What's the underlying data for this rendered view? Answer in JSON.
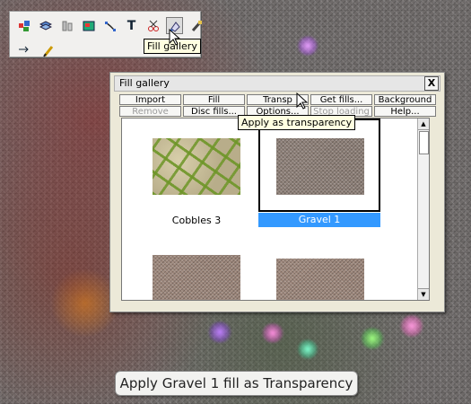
{
  "toolbar": {
    "icons": [
      "quick-shapes-icon",
      "layers-icon",
      "bars-icon",
      "bitmap-icon",
      "shape-editor-icon",
      "text-icon",
      "knife-icon",
      "fill-icon",
      "transparency-icon"
    ],
    "tooltip": "Fill gallery",
    "row2_icons": [
      "pointer-icon",
      "pen-icon"
    ]
  },
  "dialog": {
    "title": "Fill gallery",
    "close": "X",
    "row1": [
      "Import",
      "Fill",
      "Transp",
      "Get fills...",
      "Background"
    ],
    "row2": [
      "Remove",
      "Disc fills...",
      "Options...",
      "Stop loading",
      "Help..."
    ],
    "row2_disabled": [
      true,
      false,
      false,
      true,
      false
    ],
    "tooltip": "Apply as transparency",
    "items": [
      {
        "name": "Cobbles 3",
        "selected": false
      },
      {
        "name": "Gravel 1",
        "selected": true
      },
      {
        "name": "",
        "selected": false
      },
      {
        "name": "",
        "selected": false
      }
    ]
  },
  "status": "Apply Gravel 1 fill as Transparency",
  "colors": {
    "selection": "#3399ff",
    "tooltip_bg": "#ffffe1"
  }
}
